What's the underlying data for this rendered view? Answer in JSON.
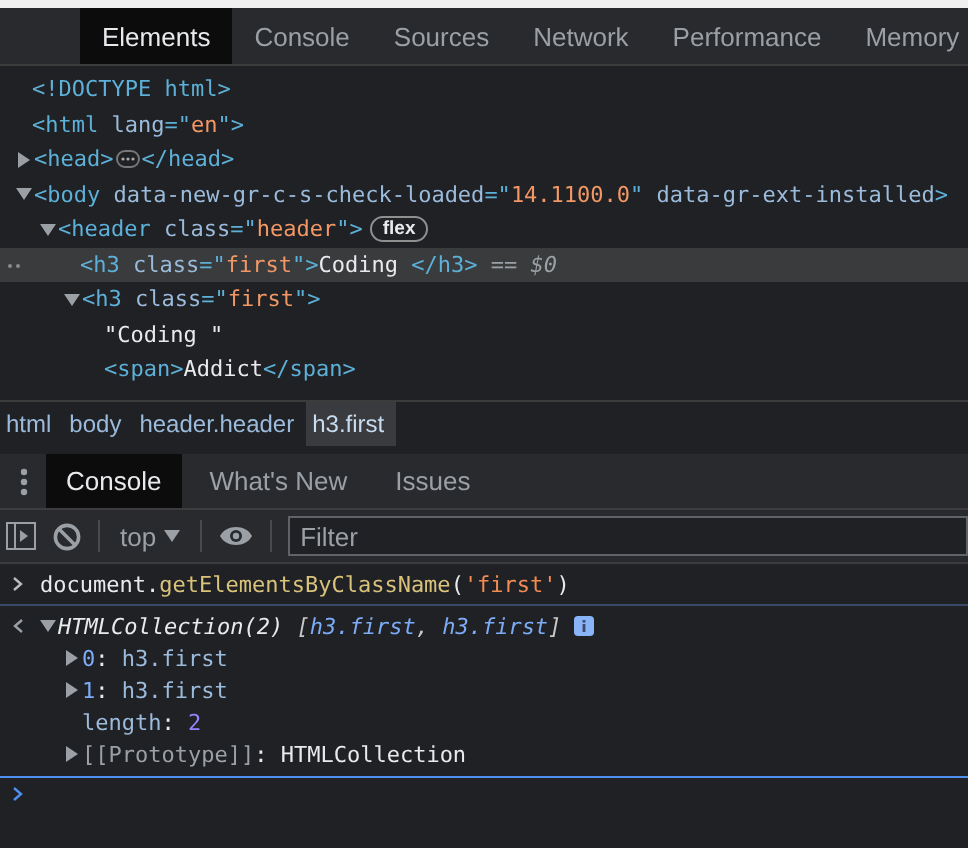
{
  "main_tabs": [
    {
      "label": "Elements",
      "selected": true
    },
    {
      "label": "Console",
      "selected": false
    },
    {
      "label": "Sources",
      "selected": false
    },
    {
      "label": "Network",
      "selected": false
    },
    {
      "label": "Performance",
      "selected": false
    },
    {
      "label": "Memory",
      "selected": false
    }
  ],
  "dom_tree": [
    {
      "tokens": [
        {
          "kind": "tag",
          "text": "<!DOCTYPE html>"
        }
      ]
    },
    {
      "tokens": [
        {
          "kind": "tag",
          "text": "<html "
        },
        {
          "kind": "attr",
          "text": "lang"
        },
        {
          "kind": "tag",
          "text": "=\""
        },
        {
          "kind": "value",
          "text": "en"
        },
        {
          "kind": "tag",
          "text": "\">"
        }
      ],
      "children": [
        {
          "expanded": false,
          "tokens": [
            {
              "kind": "tag",
              "text": "<head>"
            }
          ],
          "ellipsis": true,
          "closing": [
            {
              "kind": "tag",
              "text": "</head>"
            }
          ]
        },
        {
          "expanded": true,
          "tokens": [
            {
              "kind": "tag",
              "text": "<body "
            },
            {
              "kind": "attr",
              "text": "data-new-gr-c-s-check-loaded"
            },
            {
              "kind": "tag",
              "text": "=\""
            },
            {
              "kind": "value",
              "text": "14.1100.0"
            },
            {
              "kind": "tag",
              "text": "\" "
            },
            {
              "kind": "attr",
              "text": "data-gr-ext-installed"
            },
            {
              "kind": "tag",
              "text": ">"
            }
          ],
          "children": [
            {
              "expanded": true,
              "tokens": [
                {
                  "kind": "tag",
                  "text": "<header "
                },
                {
                  "kind": "attr",
                  "text": "class"
                },
                {
                  "kind": "tag",
                  "text": "=\""
                },
                {
                  "kind": "value",
                  "text": "header"
                },
                {
                  "kind": "tag",
                  "text": "\">"
                }
              ],
              "badge": "flex",
              "children": [
                {
                  "selected": true,
                  "tokens": [
                    {
                      "kind": "tag",
                      "text": "<h3 "
                    },
                    {
                      "kind": "attr",
                      "text": "class"
                    },
                    {
                      "kind": "tag",
                      "text": "=\""
                    },
                    {
                      "kind": "value",
                      "text": "first"
                    },
                    {
                      "kind": "tag",
                      "text": "\">"
                    },
                    {
                      "kind": "text",
                      "text": "Coding "
                    },
                    {
                      "kind": "tag",
                      "text": "</h3>"
                    },
                    {
                      "kind": "dim",
                      "text": " == "
                    },
                    {
                      "kind": "dimitalic",
                      "text": "$0"
                    }
                  ]
                },
                {
                  "selected": false,
                  "expanded": true,
                  "tokens": [
                    {
                      "kind": "tag",
                      "text": "<h3 "
                    },
                    {
                      "kind": "attr",
                      "text": "class"
                    },
                    {
                      "kind": "tag",
                      "text": "=\""
                    },
                    {
                      "kind": "value",
                      "text": "first"
                    },
                    {
                      "kind": "tag",
                      "text": "\">"
                    }
                  ],
                  "children": [
                    {
                      "tokens": [
                        {
                          "kind": "text",
                          "text": "\"Coding \""
                        }
                      ]
                    },
                    {
                      "tokens": [
                        {
                          "kind": "tag",
                          "text": "<span>"
                        },
                        {
                          "kind": "text",
                          "text": "Addict"
                        },
                        {
                          "kind": "tag",
                          "text": "</span>"
                        }
                      ]
                    }
                  ]
                }
              ]
            }
          ]
        }
      ]
    }
  ],
  "breadcrumbs": [
    {
      "label": "html",
      "selected": false
    },
    {
      "label": "body",
      "selected": false
    },
    {
      "label": "header.header",
      "selected": false
    },
    {
      "label": "h3.first",
      "selected": true
    }
  ],
  "drawer_tabs": [
    {
      "label": "Console",
      "selected": true
    },
    {
      "label": "What's New",
      "selected": false
    },
    {
      "label": "Issues",
      "selected": false
    }
  ],
  "context": "top",
  "filter": {
    "placeholder": "Filter"
  },
  "input": [
    {
      "kind": "plain",
      "text": "document."
    },
    {
      "kind": "method",
      "text": "getElementsByClassName"
    },
    {
      "kind": "plain",
      "text": "("
    },
    {
      "kind": "string",
      "text": "'first'"
    },
    {
      "kind": "plain",
      "text": ")"
    }
  ],
  "result": {
    "expanded": true,
    "tokens": [
      {
        "kind": "italic",
        "text": "HTMLCollection(2) "
      },
      {
        "kind": "italicdim",
        "text": "["
      },
      {
        "kind": "italicblue",
        "text": "h3.first"
      },
      {
        "kind": "italicdim",
        "text": ", "
      },
      {
        "kind": "italicblue",
        "text": "h3.first"
      },
      {
        "kind": "italicdim",
        "text": "]"
      }
    ],
    "properties": [
      {
        "expanded": false,
        "tokens": [
          {
            "kind": "key",
            "text": "0"
          },
          {
            "kind": "plain",
            "text": ": "
          },
          {
            "kind": "blue",
            "text": "h3.first"
          }
        ]
      },
      {
        "expanded": false,
        "tokens": [
          {
            "kind": "key",
            "text": "1"
          },
          {
            "kind": "plain",
            "text": ": "
          },
          {
            "kind": "blue",
            "text": "h3.first"
          }
        ]
      },
      {
        "tokens": [
          {
            "kind": "blue",
            "text": "length"
          },
          {
            "kind": "plain",
            "text": ": "
          },
          {
            "kind": "number",
            "text": "2"
          }
        ]
      },
      {
        "expanded": false,
        "tokens": [
          {
            "kind": "gray",
            "text": "[[Prototype]]"
          },
          {
            "kind": "plain",
            "text": ": "
          },
          {
            "kind": "plain",
            "text": "HTMLCollection"
          }
        ]
      }
    ]
  }
}
